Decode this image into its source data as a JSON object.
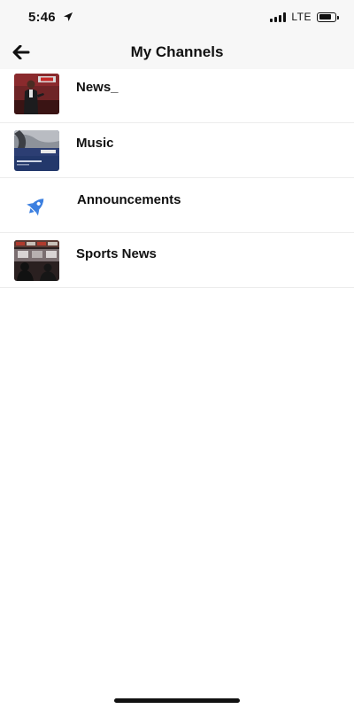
{
  "status_bar": {
    "time": "5:46",
    "network": "LTE"
  },
  "nav": {
    "back_icon": "arrow-left-icon",
    "title": "My Channels"
  },
  "channels": [
    {
      "label": "News_",
      "thumbnail": "news-thumbnail"
    },
    {
      "label": "Music",
      "thumbnail": "music-thumbnail"
    },
    {
      "label": "Announcements",
      "thumbnail": "rocket-icon",
      "accent": "#3b7fe0"
    },
    {
      "label": "Sports News",
      "thumbnail": "sports-thumbnail"
    }
  ]
}
